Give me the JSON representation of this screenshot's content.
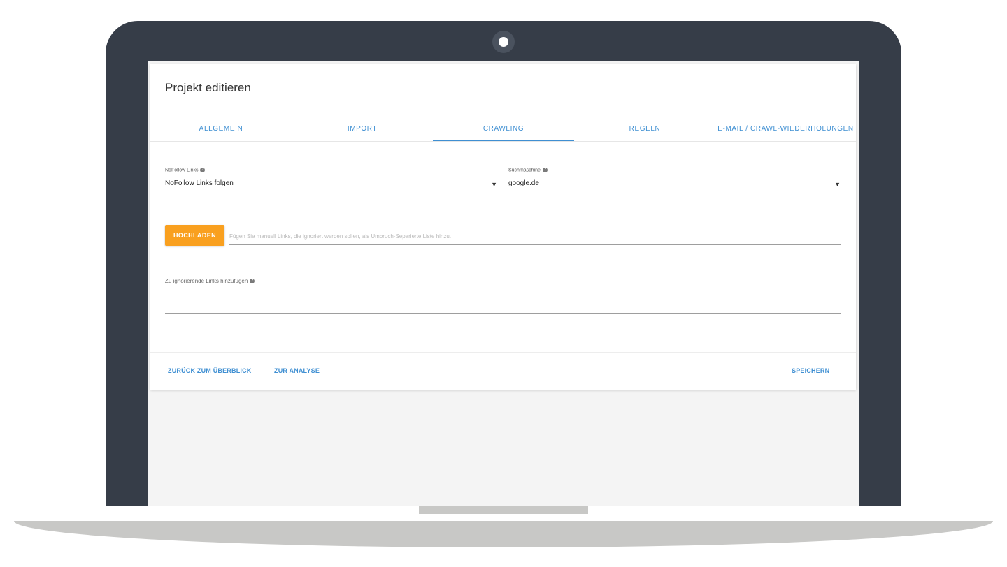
{
  "dialog": {
    "title": "Projekt editieren"
  },
  "tabs": [
    {
      "label": "ALLGEMEIN",
      "active": false
    },
    {
      "label": "IMPORT",
      "active": false
    },
    {
      "label": "CRAWLING",
      "active": true
    },
    {
      "label": "REGELN",
      "active": false
    },
    {
      "label": "E-MAIL / CRAWL-WIEDERHOLUNGEN",
      "active": false
    }
  ],
  "fields": {
    "nofollow": {
      "label": "NoFollow Links",
      "value": "NoFollow Links folgen"
    },
    "search_engine": {
      "label": "Suchmaschine",
      "value": "google.de"
    }
  },
  "upload": {
    "button_label": "HOCHLADEN",
    "placeholder": "Fügen Sie manuell Links, die ignoriert werden sollen, als Umbruch-Separierte Liste hinzu."
  },
  "ignore_links": {
    "label": "Zu ignorierende Links hinzufügen",
    "value": ""
  },
  "footer": {
    "back_label": "ZURÜCK ZUM ÜBERBLICK",
    "analysis_label": "ZUR ANALYSE",
    "save_label": "SPEICHERN"
  },
  "icons": {
    "help": "help-icon",
    "dropdown": "dropdown-arrow-icon",
    "camera": "camera-icon"
  },
  "colors": {
    "accent": "#3f8fd2",
    "upload_button": "#f9a01f",
    "laptop_frame": "#363d48",
    "laptop_base": "#c8c8c6",
    "screen_background": "#f4f4f4"
  }
}
